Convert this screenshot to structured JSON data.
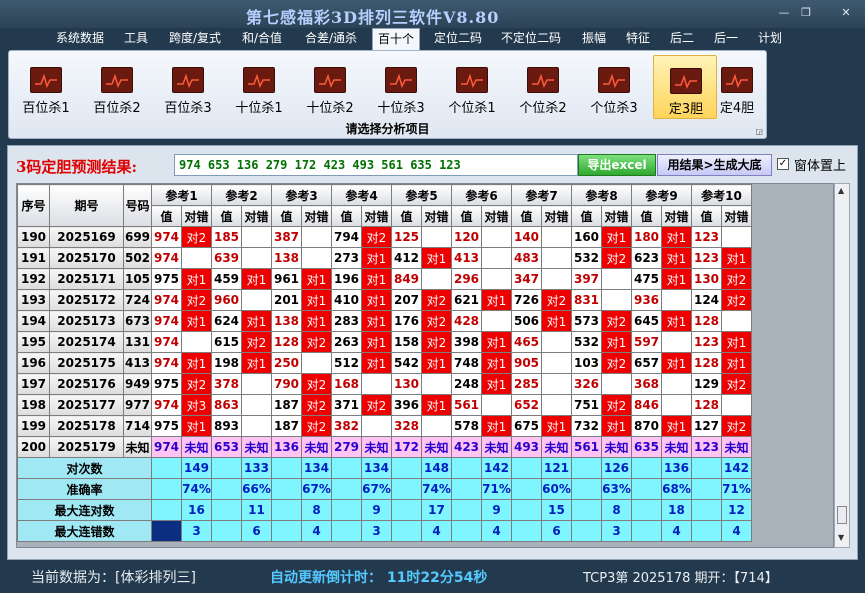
{
  "window": {
    "title": "第七感福彩3D排列三软件V8.80",
    "minimize": "—",
    "restore": "❐",
    "close": "✕"
  },
  "menu": [
    "系统数据",
    "工具",
    "跨度/复式",
    "和/合值",
    "合差/通杀",
    "百十个",
    "定位二码",
    "不定位二码",
    "振幅",
    "特征",
    "后二",
    "后一",
    "计划"
  ],
  "menu_active": "百十个",
  "ribbon": {
    "buttons": [
      "百位杀1",
      "百位杀2",
      "百位杀3",
      "十位杀1",
      "十位杀2",
      "十位杀3",
      "个位杀1",
      "个位杀2",
      "个位杀3",
      "定3胆",
      "定4胆"
    ],
    "selected": "定3胆",
    "caption": "请选择分析项目",
    "corner": "◲"
  },
  "result": {
    "label": "3码定胆预测结果:",
    "value": "974 653 136 279 172 423 493 561 635 123",
    "export_button": "导出excel",
    "generate_button": "用结果>生成大底",
    "always_on_top_label": "窗体置上",
    "always_on_top_checked": "✓"
  },
  "table": {
    "headers": {
      "seq": "序号",
      "period": "期号",
      "number": "号码",
      "refs": [
        "参考1",
        "参考2",
        "参考3",
        "参考4",
        "参考5",
        "参考6",
        "参考7",
        "参考8",
        "参考9",
        "参考10"
      ],
      "sub_value": "值",
      "sub_check": "对错"
    },
    "rows": [
      {
        "seq": "190",
        "period": "2025169",
        "num": "699",
        "cells": [
          [
            "974",
            "对2"
          ],
          [
            "185",
            ""
          ],
          [
            "387",
            ""
          ],
          [
            "794",
            "对2"
          ],
          [
            "125",
            ""
          ],
          [
            "120",
            ""
          ],
          [
            "140",
            ""
          ],
          [
            "160",
            "对1"
          ],
          [
            "180",
            "对1"
          ],
          [
            "123",
            ""
          ]
        ]
      },
      {
        "seq": "191",
        "period": "2025170",
        "num": "502",
        "cells": [
          [
            "974",
            ""
          ],
          [
            "639",
            ""
          ],
          [
            "138",
            ""
          ],
          [
            "273",
            "对1"
          ],
          [
            "412",
            "对1"
          ],
          [
            "413",
            ""
          ],
          [
            "483",
            ""
          ],
          [
            "532",
            "对2"
          ],
          [
            "623",
            "对1"
          ],
          [
            "123",
            "对1"
          ]
        ]
      },
      {
        "seq": "192",
        "period": "2025171",
        "num": "105",
        "cells": [
          [
            "975",
            "对1"
          ],
          [
            "459",
            "对1"
          ],
          [
            "961",
            "对1"
          ],
          [
            "196",
            "对1"
          ],
          [
            "849",
            ""
          ],
          [
            "296",
            ""
          ],
          [
            "347",
            ""
          ],
          [
            "397",
            ""
          ],
          [
            "475",
            "对1"
          ],
          [
            "130",
            "对2"
          ]
        ]
      },
      {
        "seq": "193",
        "period": "2025172",
        "num": "724",
        "cells": [
          [
            "974",
            "对2"
          ],
          [
            "960",
            ""
          ],
          [
            "201",
            "对1"
          ],
          [
            "410",
            "对1"
          ],
          [
            "207",
            "对2"
          ],
          [
            "621",
            "对1"
          ],
          [
            "726",
            "对2"
          ],
          [
            "831",
            ""
          ],
          [
            "936",
            ""
          ],
          [
            "124",
            "对2"
          ]
        ]
      },
      {
        "seq": "194",
        "period": "2025173",
        "num": "673",
        "cells": [
          [
            "974",
            "对1"
          ],
          [
            "624",
            "对1"
          ],
          [
            "138",
            "对1"
          ],
          [
            "283",
            "对1"
          ],
          [
            "176",
            "对2"
          ],
          [
            "428",
            ""
          ],
          [
            "506",
            "对1"
          ],
          [
            "573",
            "对2"
          ],
          [
            "645",
            "对1"
          ],
          [
            "128",
            ""
          ]
        ]
      },
      {
        "seq": "195",
        "period": "2025174",
        "num": "131",
        "cells": [
          [
            "974",
            ""
          ],
          [
            "615",
            "对2"
          ],
          [
            "128",
            "对2"
          ],
          [
            "263",
            "对1"
          ],
          [
            "158",
            "对2"
          ],
          [
            "398",
            "对1"
          ],
          [
            "465",
            ""
          ],
          [
            "532",
            "对1"
          ],
          [
            "597",
            ""
          ],
          [
            "123",
            "对1"
          ]
        ]
      },
      {
        "seq": "196",
        "period": "2025175",
        "num": "413",
        "cells": [
          [
            "974",
            "对1"
          ],
          [
            "198",
            "对1"
          ],
          [
            "250",
            ""
          ],
          [
            "512",
            "对1"
          ],
          [
            "542",
            "对1"
          ],
          [
            "748",
            "对1"
          ],
          [
            "905",
            ""
          ],
          [
            "103",
            "对2"
          ],
          [
            "657",
            "对1"
          ],
          [
            "128",
            "对1"
          ]
        ]
      },
      {
        "seq": "197",
        "period": "2025176",
        "num": "949",
        "cells": [
          [
            "975",
            "对2"
          ],
          [
            "378",
            ""
          ],
          [
            "790",
            "对2"
          ],
          [
            "168",
            ""
          ],
          [
            "130",
            ""
          ],
          [
            "248",
            "对1"
          ],
          [
            "285",
            ""
          ],
          [
            "326",
            ""
          ],
          [
            "368",
            ""
          ],
          [
            "129",
            "对2"
          ]
        ]
      },
      {
        "seq": "198",
        "period": "2025177",
        "num": "977",
        "cells": [
          [
            "974",
            "对3"
          ],
          [
            "863",
            ""
          ],
          [
            "187",
            "对2"
          ],
          [
            "371",
            "对2"
          ],
          [
            "396",
            "对1"
          ],
          [
            "561",
            ""
          ],
          [
            "652",
            ""
          ],
          [
            "751",
            "对2"
          ],
          [
            "846",
            ""
          ],
          [
            "128",
            ""
          ]
        ]
      },
      {
        "seq": "199",
        "period": "2025178",
        "num": "714",
        "cells": [
          [
            "975",
            "对1"
          ],
          [
            "893",
            ""
          ],
          [
            "187",
            "对2"
          ],
          [
            "382",
            ""
          ],
          [
            "328",
            ""
          ],
          [
            "578",
            "对1"
          ],
          [
            "675",
            "对1"
          ],
          [
            "732",
            "对1"
          ],
          [
            "870",
            "对1"
          ],
          [
            "127",
            "对2"
          ]
        ]
      }
    ],
    "predict_row": {
      "seq": "200",
      "period": "2025179",
      "num": "未知",
      "values": [
        "974",
        "653",
        "136",
        "279",
        "172",
        "423",
        "493",
        "561",
        "635",
        "123"
      ],
      "check": "未知"
    },
    "red_values": [
      "185",
      "387",
      "125",
      "120",
      "140",
      "180",
      "123",
      "974",
      "639",
      "138",
      "413",
      "483",
      "849",
      "296",
      "347",
      "397",
      "960",
      "831",
      "936",
      "428",
      "128",
      "465",
      "597",
      "250",
      "905",
      "378",
      "790",
      "168",
      "130",
      "285",
      "326",
      "368",
      "863",
      "561",
      "652",
      "846",
      "382",
      "328"
    ],
    "stats": [
      {
        "label": "对次数",
        "values": [
          "149",
          "133",
          "134",
          "134",
          "148",
          "142",
          "121",
          "126",
          "136",
          "142"
        ]
      },
      {
        "label": "准确率",
        "values": [
          "74%",
          "66%",
          "67%",
          "67%",
          "74%",
          "71%",
          "60%",
          "63%",
          "68%",
          "71%"
        ]
      },
      {
        "label": "最大连对数",
        "values": [
          "16",
          "11",
          "8",
          "9",
          "17",
          "9",
          "15",
          "8",
          "18",
          "12"
        ]
      },
      {
        "label": "最大连错数",
        "values": [
          "3",
          "6",
          "4",
          "3",
          "4",
          "4",
          "6",
          "3",
          "4",
          "4"
        ]
      }
    ]
  },
  "scrollbar": {
    "up": "▲",
    "down": "▼"
  },
  "status": {
    "source": "当前数据为：[体彩排列三]",
    "countdown": "自动更新倒计时：  11时22分54秒",
    "issue": "TCP3第 2025178 期开：【714】"
  }
}
